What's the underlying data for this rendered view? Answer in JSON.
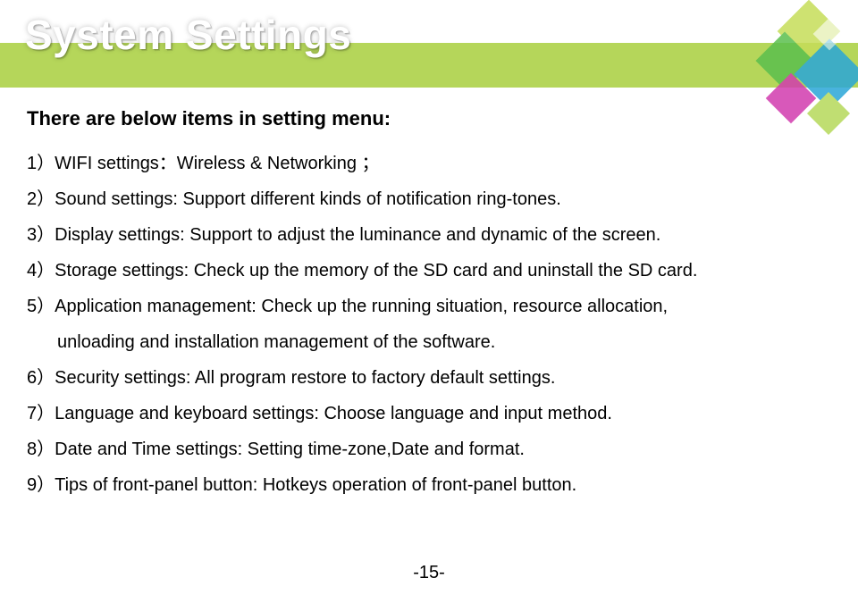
{
  "title": "System Settings",
  "intro": "There are below items in setting menu:",
  "items": [
    "1）WIFI settings：Wireless & Networking ；",
    "2）Sound settings: Support different kinds of notification ring-tones.",
    "3）Display settings: Support to adjust the luminance and dynamic of the screen.",
    "4）Storage settings: Check up the memory of the SD card and uninstall the SD card.",
    "5）Application management: Check up the running situation, resource allocation,",
    "unloading and installation management of the software.",
    "6）Security settings: All program restore to factory default settings.",
    "7）Language and keyboard settings: Choose language and input method.",
    "8）Date and Time settings: Setting time-zone,Date and format.",
    "9）Tips of front-panel button: Hotkeys operation of front-panel button."
  ],
  "indentIndices": [
    5
  ],
  "pageNumber": "-15-"
}
